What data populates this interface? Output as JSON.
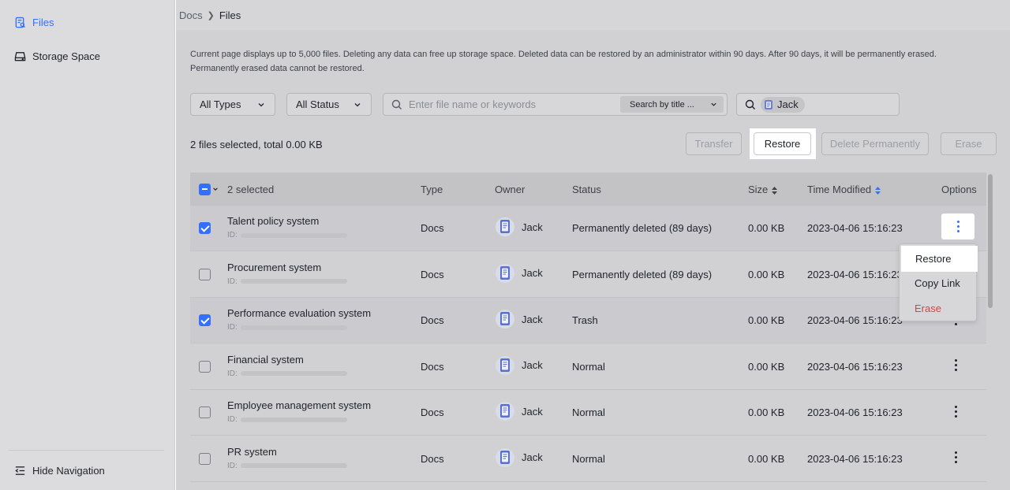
{
  "sidebar": {
    "files_label": "Files",
    "storage_label": "Storage Space",
    "hide_label": "Hide Navigation"
  },
  "breadcrumb": {
    "parent": "Docs",
    "current": "Files"
  },
  "notice": "Current page displays up to 5,000 files. Deleting any data can free up storage space. Deleted data can be restored by an administrator within 90 days. After 90 days, it will be permanently erased. Permanently erased data cannot be restored.",
  "filters": {
    "types": "All Types",
    "status": "All Status",
    "search_placeholder": "Enter file name or keywords",
    "search_mode": "Search by title ...",
    "owner_chip": "Jack"
  },
  "selection": {
    "summary": "2 files selected, total 0.00 KB"
  },
  "actions": {
    "transfer": "Transfer",
    "restore": "Restore",
    "delete_permanently": "Delete Permanently",
    "erase": "Erase"
  },
  "table": {
    "headers": {
      "selected": "2 selected",
      "type": "Type",
      "owner": "Owner",
      "status": "Status",
      "size": "Size",
      "time": "Time Modified",
      "options": "Options"
    },
    "id_label": "ID:",
    "rows": [
      {
        "name": "Talent policy system",
        "type": "Docs",
        "owner": "Jack",
        "status": "Permanently deleted (89 days)",
        "size": "0.00 KB",
        "time": "2023-04-06 15:16:23",
        "checked": true
      },
      {
        "name": "Procurement system",
        "type": "Docs",
        "owner": "Jack",
        "status": "Permanently deleted (89 days)",
        "size": "0.00 KB",
        "time": "2023-04-06 15:16:23",
        "checked": false
      },
      {
        "name": "Performance evaluation system",
        "type": "Docs",
        "owner": "Jack",
        "status": "Trash",
        "size": "0.00 KB",
        "time": "2023-04-06 15:16:23",
        "checked": true
      },
      {
        "name": "Financial system",
        "type": "Docs",
        "owner": "Jack",
        "status": "Normal",
        "size": "0.00 KB",
        "time": "2023-04-06 15:16:23",
        "checked": false
      },
      {
        "name": "Employee management system",
        "type": "Docs",
        "owner": "Jack",
        "status": "Normal",
        "size": "0.00 KB",
        "time": "2023-04-06 15:16:23",
        "checked": false
      },
      {
        "name": "PR system",
        "type": "Docs",
        "owner": "Jack",
        "status": "Normal",
        "size": "0.00 KB",
        "time": "2023-04-06 15:16:23",
        "checked": false
      }
    ]
  },
  "menu": {
    "restore": "Restore",
    "copy_link": "Copy Link",
    "erase": "Erase"
  },
  "colors": {
    "accent": "#3370ff",
    "danger": "#d0473c"
  }
}
